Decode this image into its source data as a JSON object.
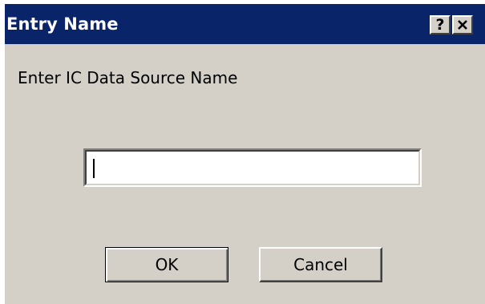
{
  "dialog": {
    "title": "Entry Name",
    "help_button": "?",
    "prompt": "Enter IC Data Source Name",
    "input": {
      "value": "",
      "placeholder": ""
    },
    "buttons": {
      "ok": "OK",
      "cancel": "Cancel"
    }
  },
  "colors": {
    "titlebar": "#0a246a",
    "title_text": "#ffffff",
    "dialog_background": "#d4d0c8"
  },
  "icons": {
    "help": "question-mark-icon",
    "close": "close-x-icon"
  }
}
